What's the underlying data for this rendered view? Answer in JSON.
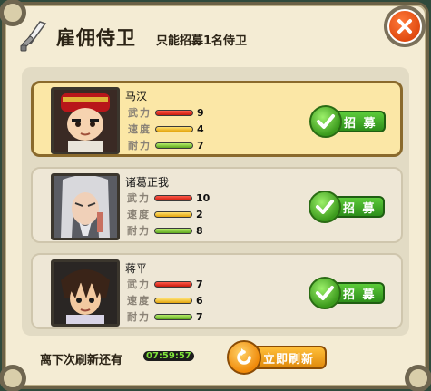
{
  "header": {
    "title": "雇佣侍卫",
    "subtitle": "只能招募1名侍卫"
  },
  "guards": [
    {
      "name": "马汉",
      "selected": true,
      "recruit_label": "招 募",
      "stats": [
        {
          "label": "武力",
          "value": "9",
          "color": "red"
        },
        {
          "label": "速度",
          "value": "4",
          "color": "yellow"
        },
        {
          "label": "耐力",
          "value": "7",
          "color": "green"
        }
      ]
    },
    {
      "name": "诸葛正我",
      "selected": false,
      "recruit_label": "招 募",
      "stats": [
        {
          "label": "武力",
          "value": "10",
          "color": "red"
        },
        {
          "label": "速度",
          "value": "2",
          "color": "yellow"
        },
        {
          "label": "耐力",
          "value": "8",
          "color": "green"
        }
      ]
    },
    {
      "name": "蒋平",
      "selected": false,
      "recruit_label": "招 募",
      "stats": [
        {
          "label": "武力",
          "value": "7",
          "color": "red"
        },
        {
          "label": "速度",
          "value": "6",
          "color": "yellow"
        },
        {
          "label": "耐力",
          "value": "7",
          "color": "green"
        }
      ]
    }
  ],
  "footer": {
    "refresh_label": "离下次刷新还有",
    "timer": "07:59:57",
    "refresh_button": "立即刷新"
  },
  "colors": {
    "panel_bg": "#f4ecd4",
    "selected_card": "#fbe7a6",
    "recruit_green": "#2d8e1a",
    "refresh_orange": "#e08a0c",
    "close_orange": "#e04a10"
  }
}
